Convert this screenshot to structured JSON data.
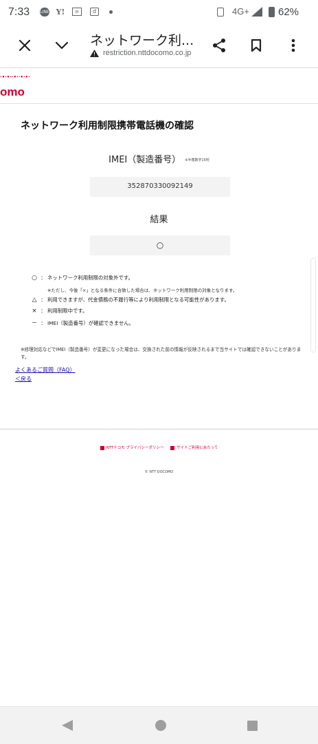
{
  "status_bar": {
    "time": "7:33",
    "line_icon": "LINE",
    "yahoo_icon": "Y!",
    "d_icon": "d",
    "network": "4G+",
    "battery": "62%"
  },
  "toolbar": {
    "title": "ネットワーク利...",
    "url": "restriction.nttdocomo.co.jp"
  },
  "page": {
    "logo_dots": "·•·•··•··•·•·",
    "logo": "omo",
    "title": "ネットワーク利用制限携帯電話機の確認",
    "imei_label": "IMEI（製造番号）",
    "imei_note": "※半角数字15桁",
    "imei_value": "352870330092149",
    "result_label": "結果",
    "result_value": "○",
    "legend": [
      {
        "symbol": "○",
        "text": "ネットワーク利用制限の対象外です。"
      },
      {
        "symbol": "△",
        "text": "利用できますが、代金債務の不履行等により利用制限となる可能性があります。"
      },
      {
        "symbol": "×",
        "text": "利用制限中です。"
      },
      {
        "symbol": "－",
        "text": "IMEI（製造番号）が確認できません。"
      }
    ],
    "legend_sub": "※ただし、今後「×」となる条件に合致した場合は、ネットワーク利用制限の対象となります。",
    "footnote": "※修理対応などでIMEI（製造番号）が変更になった場合は、交換された前の情報が反映されるまで当サイトでは確認できないことがあります。",
    "faq_link": "よくあるご質問（FAQ）",
    "back_link": "＜戻る"
  },
  "footer": {
    "privacy": "NTTドコモ プライバシーポリシー",
    "terms": "サイトご利用にあたって",
    "copyright": "© NTT DOCOMO"
  }
}
